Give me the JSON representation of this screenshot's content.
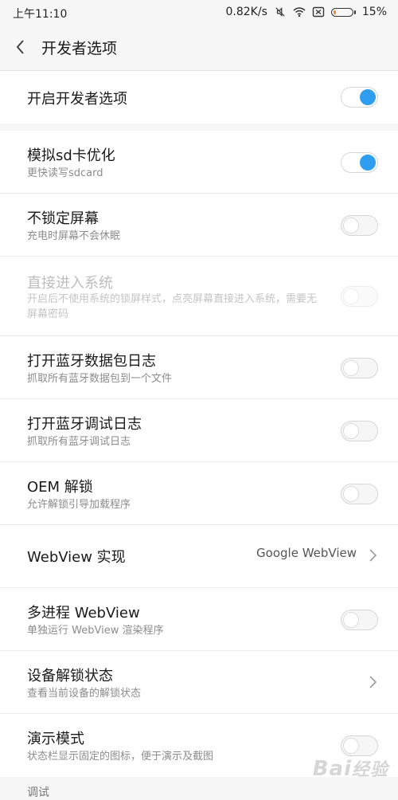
{
  "status_bar": {
    "time": "上午11:10",
    "speed": "0.82K/s",
    "battery_percent": "15%",
    "battery_level": 0.15,
    "icons": [
      "mute-icon",
      "wifi-icon",
      "sim-icon",
      "battery-icon"
    ]
  },
  "header": {
    "title": "开发者选项",
    "back_icon": "back-chevron-icon"
  },
  "rows": {
    "developer": {
      "label": "开启开发者选项",
      "on": true
    },
    "sd_opt": {
      "label": "模拟sd卡优化",
      "sub": "更快读写sdcard",
      "on": true
    },
    "stay_awake": {
      "label": "不锁定屏幕",
      "sub": "充电时屏幕不会休眠",
      "on": false
    },
    "direct_entry": {
      "label": "直接进入系统",
      "sub": "开启后不使用系统的锁屏样式，点亮屏幕直接进入系统，需要无屏幕密码",
      "on": false,
      "disabled": true
    },
    "bt_snoop": {
      "label": "打开蓝牙数据包日志",
      "sub": "抓取所有蓝牙数据包到一个文件",
      "on": false
    },
    "bt_debug": {
      "label": "打开蓝牙调试日志",
      "sub": "抓取所有蓝牙调试日志",
      "on": false
    },
    "oem_unlock": {
      "label": "OEM 解锁",
      "sub": "允许解锁引导加载程序",
      "on": false
    },
    "webview_impl": {
      "label": "WebView 实现",
      "value": "Google WebView"
    },
    "multiprocess_webview": {
      "label": "多进程 WebView",
      "sub": "单独运行 WebView 渲染程序",
      "on": false
    },
    "unlock_status": {
      "label": "设备解锁状态",
      "sub": "查看当前设备的解锁状态"
    },
    "demo_mode": {
      "label": "演示模式",
      "sub": "状态栏显示固定的图标，便于演示及截图",
      "on": false
    }
  },
  "section_debug": "调试",
  "watermark": "Baidu 经验",
  "colors": {
    "accent": "#2f9ef0",
    "background": "#f7f7f7",
    "card": "#ffffff"
  }
}
